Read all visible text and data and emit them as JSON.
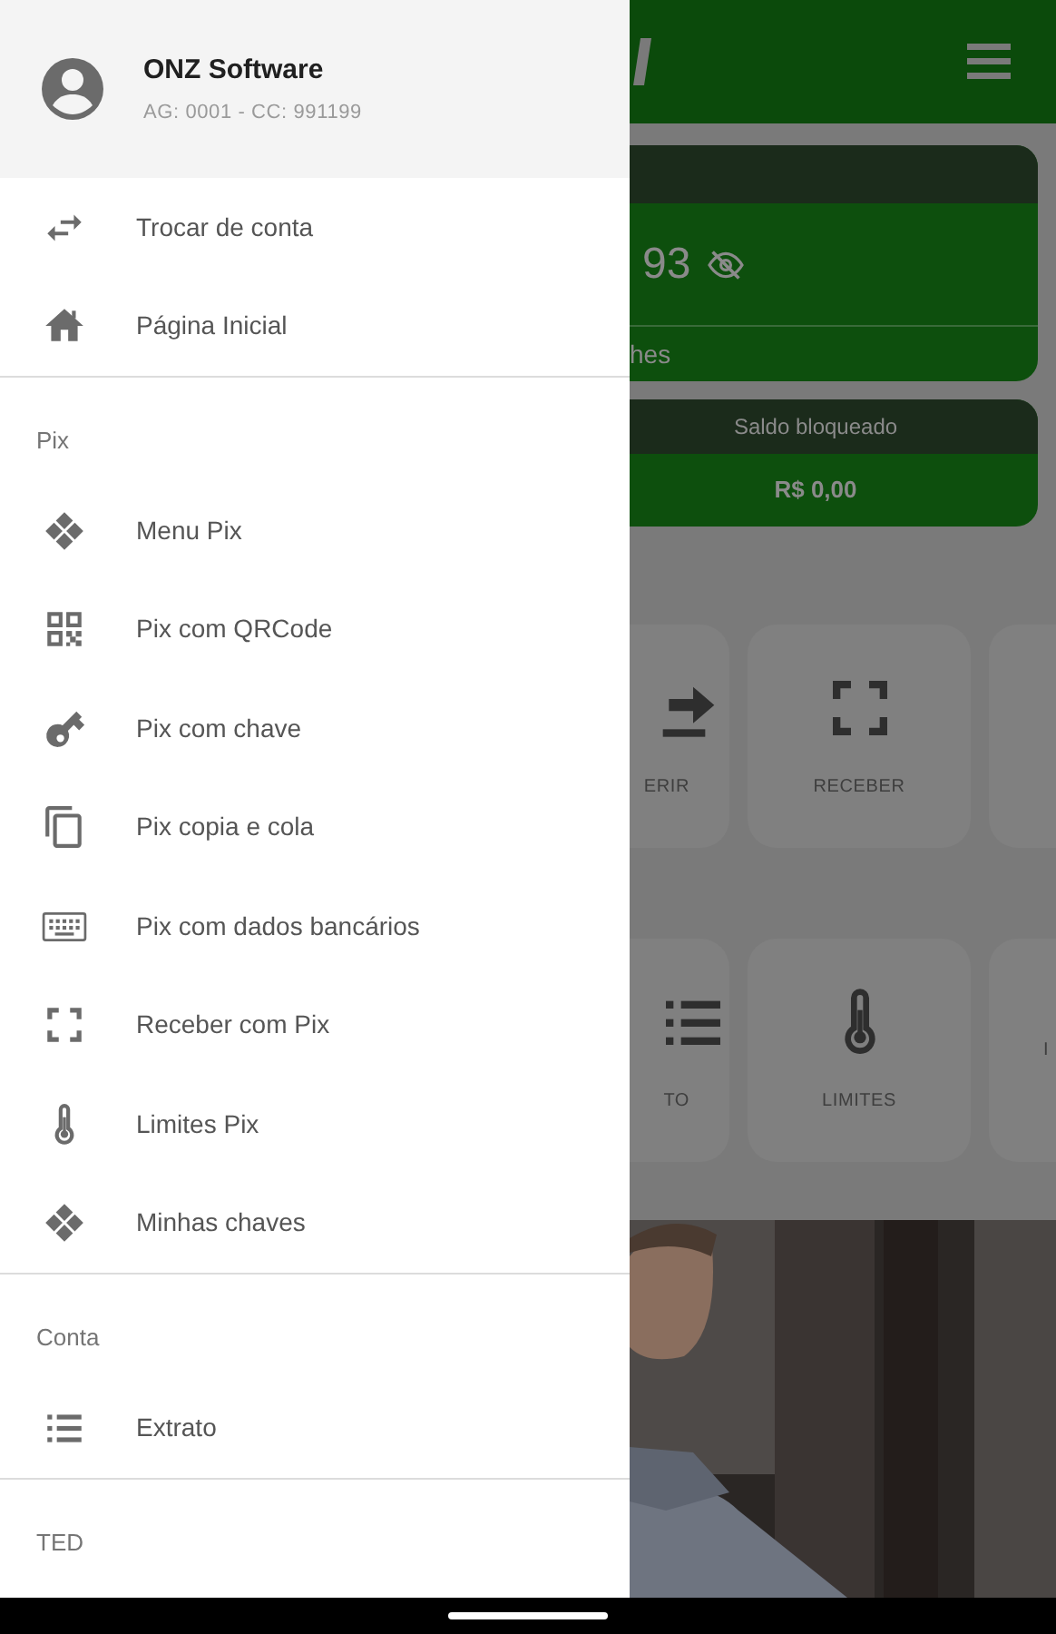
{
  "drawer": {
    "account_name": "ONZ Software",
    "account_info": "AG: 0001 - CC: 991199",
    "sections": [
      {
        "items": [
          {
            "label": "Trocar de conta",
            "kind": "swap"
          },
          {
            "label": "Página Inicial",
            "kind": "home"
          }
        ]
      },
      {
        "title": "Pix",
        "items": [
          {
            "label": "Menu Pix",
            "kind": "diamond"
          },
          {
            "label": "Pix com QRCode",
            "kind": "qrcode"
          },
          {
            "label": "Pix com chave",
            "kind": "key"
          },
          {
            "label": "Pix copia e cola",
            "kind": "copy"
          },
          {
            "label": "Pix com dados bancários",
            "kind": "keyboard"
          },
          {
            "label": "Receber com Pix",
            "kind": "scan"
          },
          {
            "label": "Limites Pix",
            "kind": "thermometer"
          },
          {
            "label": "Minhas chaves",
            "kind": "diamond"
          }
        ]
      },
      {
        "title": "Conta",
        "items": [
          {
            "label": "Extrato",
            "kind": "list"
          }
        ]
      },
      {
        "title": "TED"
      }
    ]
  },
  "balance_card": {
    "value": "93",
    "footer": "hes"
  },
  "blocked_card": {
    "title": "Saldo bloqueado",
    "value": "R$ 0,00"
  },
  "tile_rows": [
    [
      {
        "label": "ERIR",
        "kind": "transfer"
      },
      {
        "label": "RECEBER",
        "kind": "scan"
      },
      {
        "kind": "blank"
      }
    ],
    [
      {
        "label": "TO",
        "kind": "list"
      },
      {
        "label": "LIMITES",
        "kind": "thermometer"
      },
      {
        "label": "I",
        "kind": "blank"
      }
    ]
  ],
  "banner": {
    "kind": "picture"
  }
}
